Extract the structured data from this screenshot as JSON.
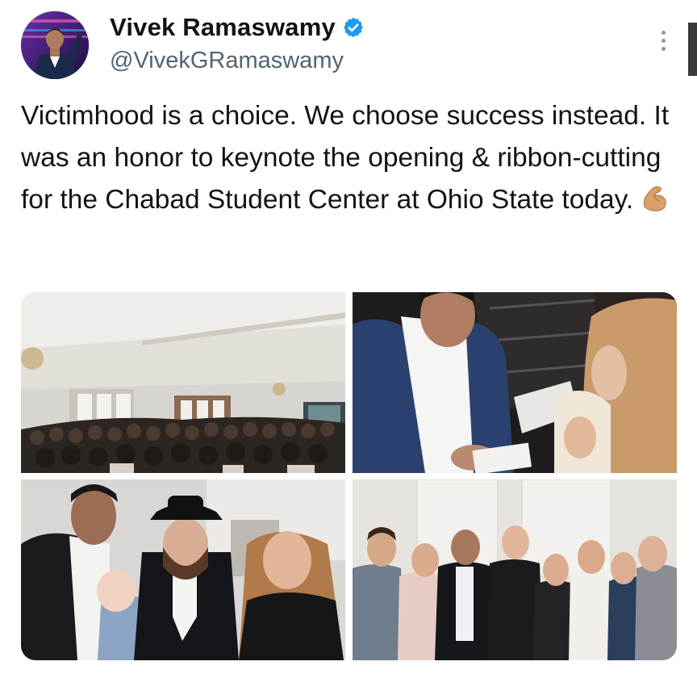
{
  "tweet": {
    "author": {
      "display_name": "Vivek Ramaswamy",
      "handle": "@VivekGRamaswamy",
      "verified": true,
      "avatar_icon": "profile-photo"
    },
    "text": "Victimhood is a choice. We choose success instead. It was an honor to keynote the opening & ribbon-cutting for the Chabad Student Center at Ohio State today.",
    "emoji": "flexed-biceps",
    "more_icon": "more-vertical-icon",
    "media": [
      {
        "id": "photo-audience",
        "depicts": "audience-hall"
      },
      {
        "id": "photo-signing",
        "depicts": "autograph-signing"
      },
      {
        "id": "photo-group-small",
        "depicts": "group-with-baby"
      },
      {
        "id": "photo-group-large",
        "depicts": "group-of-students"
      }
    ]
  },
  "colors": {
    "text_primary": "#0f1419",
    "text_secondary": "#536471",
    "verified_blue": "#1d9bf0",
    "background": "#ffffff"
  }
}
